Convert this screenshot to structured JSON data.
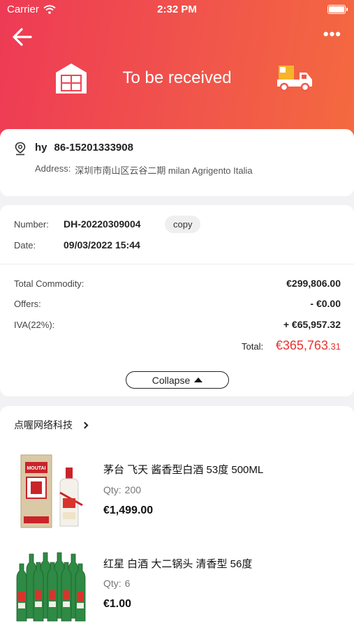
{
  "status_bar": {
    "carrier": "Carrier",
    "time": "2:32 PM"
  },
  "header": {
    "status_title": "To be received",
    "more_label": "•••"
  },
  "address": {
    "name": "hy",
    "phone": "86-15201333908",
    "label": "Address:",
    "value": "深圳市南山区云谷二期 milan Agrigento Italia"
  },
  "order": {
    "number_label": "Number:",
    "number_value": "DH-20220309004",
    "copy_label": "copy",
    "date_label": "Date:",
    "date_value": "09/03/2022 15:44"
  },
  "summary": {
    "commodity_label": "Total Commodity:",
    "commodity_value": "€299,806.00",
    "offers_label": "Offers:",
    "offers_value": "- €0.00",
    "iva_label": "IVA(22%):",
    "iva_value": "+ €65,957.32",
    "total_label": "Total:",
    "total_main": "€365,763",
    "total_decimal": ".31",
    "collapse_label": "Collapse"
  },
  "shop": {
    "name": "点喔网络科技"
  },
  "products": [
    {
      "name": "茅台 飞天 酱香型白酒 53度 500ML",
      "qty_label": "Qty:",
      "qty": "200",
      "price": "€1,499.00",
      "brand_mark": "MOUTAI"
    },
    {
      "name": "红星 白酒 大二锅头 清香型 56度",
      "qty_label": "Qty:",
      "qty": "6",
      "price": "€1.00"
    }
  ],
  "colors": {
    "header_start": "#ee3a55",
    "header_end": "#f46a3f",
    "total_red": "#e8332f"
  }
}
